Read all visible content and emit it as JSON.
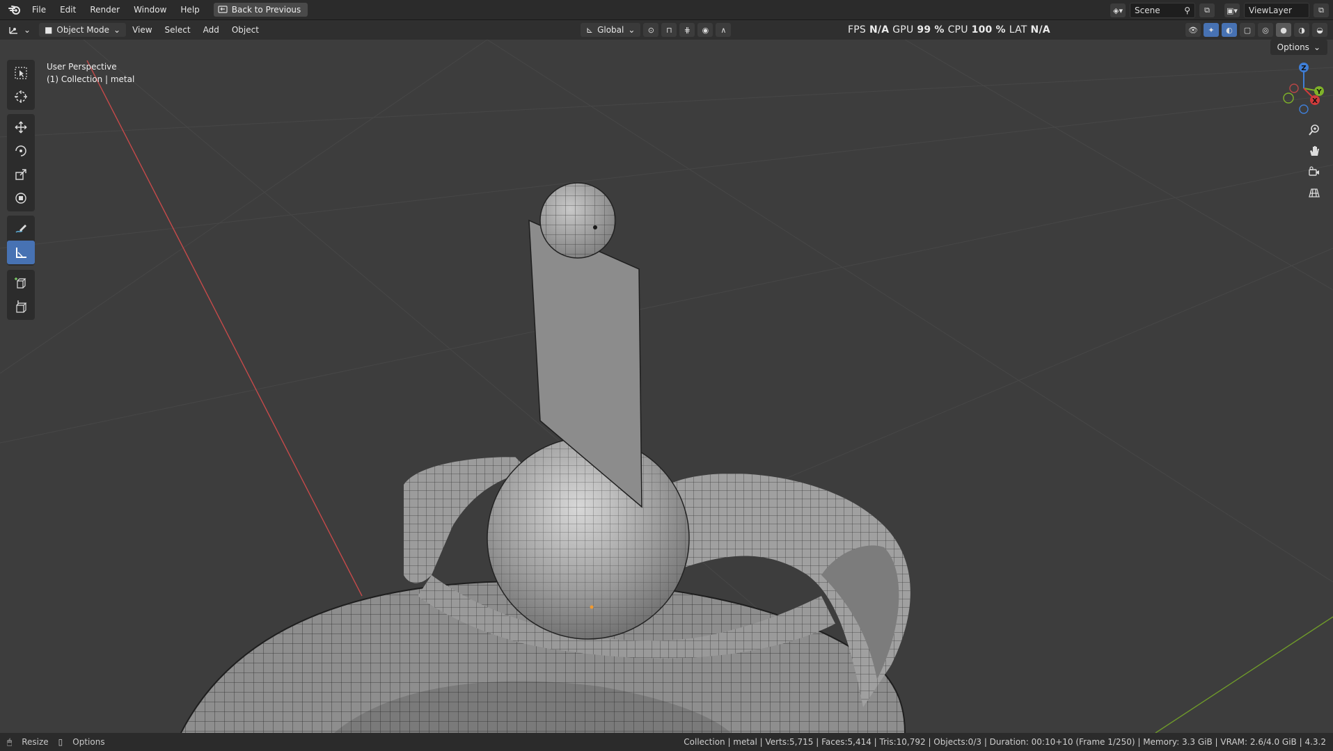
{
  "menubar": {
    "items": [
      "File",
      "Edit",
      "Render",
      "Window",
      "Help"
    ],
    "back_button": "Back to Previous",
    "scene": "Scene",
    "view_layer": "ViewLayer"
  },
  "viewport_header": {
    "mode": "Object Mode",
    "menus": [
      "View",
      "Select",
      "Add",
      "Object"
    ],
    "orientation": "Global"
  },
  "stats": {
    "fps_label": "FPS",
    "fps_value": "N/A",
    "gpu_label": "GPU",
    "gpu_value": "99 %",
    "cpu_label": "CPU",
    "cpu_value": "100 %",
    "lat_label": "LAT",
    "lat_value": "N/A"
  },
  "viewport": {
    "perspective": "User Perspective",
    "collection": "(1) Collection | metal",
    "options": "Options"
  },
  "gizmo": {
    "z": "Z",
    "y": "Y",
    "x": "X"
  },
  "toolbar": {
    "tools": [
      "select-box-icon",
      "cursor-icon",
      "move-icon",
      "rotate-icon",
      "scale-icon",
      "transform-icon",
      "annotate-icon",
      "measure-icon",
      "add-cube-icon",
      "extrude-icon"
    ],
    "active": "measure-icon"
  },
  "statusbar": {
    "resize": "Resize",
    "options": "Options",
    "info": "Collection | metal | Verts:5,715 | Faces:5,414 | Tris:10,792 | Objects:0/3 | Duration: 00:10+10 (Frame 1/250) | Memory: 3.3 GiB | VRAM: 2.6/4.0 GiB | 4.3.2"
  },
  "colors": {
    "accent": "#4772b3",
    "x_axis": "#d13b3b",
    "y_axis": "#7fb229",
    "viewport_bg": "#3d3d3d"
  }
}
